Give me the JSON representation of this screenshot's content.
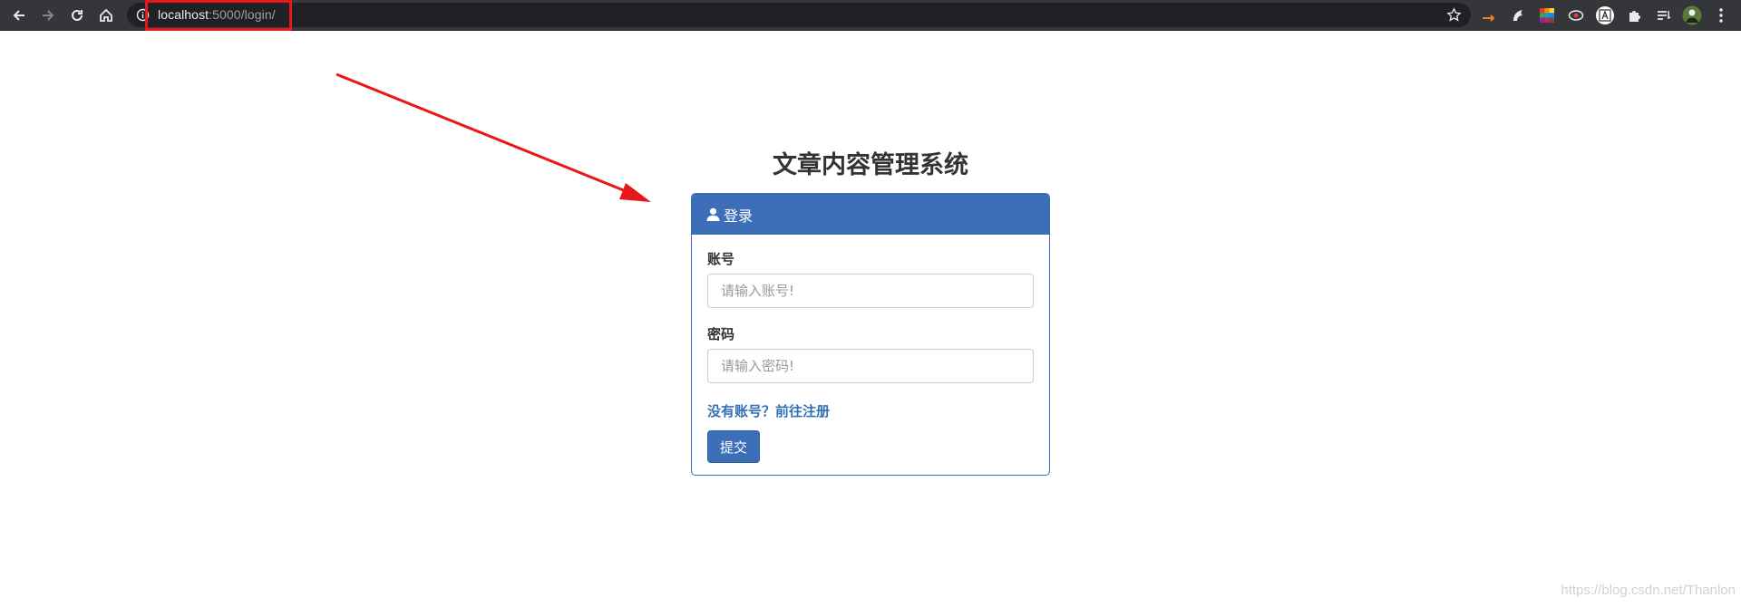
{
  "browser": {
    "url_host": "localhost",
    "url_path": ":5000/login/",
    "icons": [
      "back-icon",
      "forward-icon",
      "reload-icon",
      "home-icon",
      "info-icon",
      "star-icon"
    ],
    "extension_icons": [
      "arrow-extension-icon",
      "wolf-extension-icon",
      "color-palette-extension-icon",
      "eye-extension-icon",
      "translate-extension-icon",
      "puzzle-icon",
      "reading-list-icon",
      "profile-avatar",
      "more-menu-icon"
    ]
  },
  "annotation": {
    "color": "#e8171b"
  },
  "page": {
    "title": "文章内容管理系统"
  },
  "login_panel": {
    "heading": "登录",
    "account_label": "账号",
    "account_placeholder": "请输入账号!",
    "password_label": "密码",
    "password_placeholder": "请输入密码!",
    "register_link": "没有账号？前往注册",
    "submit_label": "提交"
  },
  "colors": {
    "primary": "#3d6fb9",
    "link": "#3470b5",
    "toolbar": "#35363a"
  },
  "watermark": "https://blog.csdn.net/Thanlon"
}
